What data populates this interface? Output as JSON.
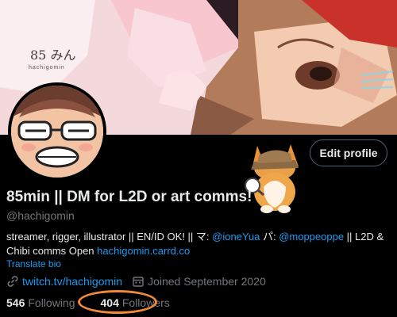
{
  "profile": {
    "display_name": "85min || DM for L2D or art comms!",
    "handle": "@hachigomin",
    "edit_profile_label": "Edit profile",
    "bio": {
      "part1": "streamer, rigger, illustrator || EN/ID OK! || マ: ",
      "mention1": "@ioneYua",
      "part2": " パ: ",
      "mention2": "@moppeoppe",
      "part3": " || L2D & Chibi comms Open ",
      "link": "hachigomin.carrd.co"
    },
    "translate_label": "Translate bio",
    "website": "twitch.tv/hachigomin",
    "joined": "Joined September 2020",
    "following_count": "546",
    "following_label": "Following",
    "followers_count": "404",
    "followers_label": "Followers"
  },
  "banner": {
    "signature": "85 みん",
    "subtext": "hachigomin"
  },
  "colors": {
    "accent": "#1d9bf0",
    "highlight_circle": "#f08a38",
    "muted": "#71767b",
    "text": "#e7e9ea"
  }
}
